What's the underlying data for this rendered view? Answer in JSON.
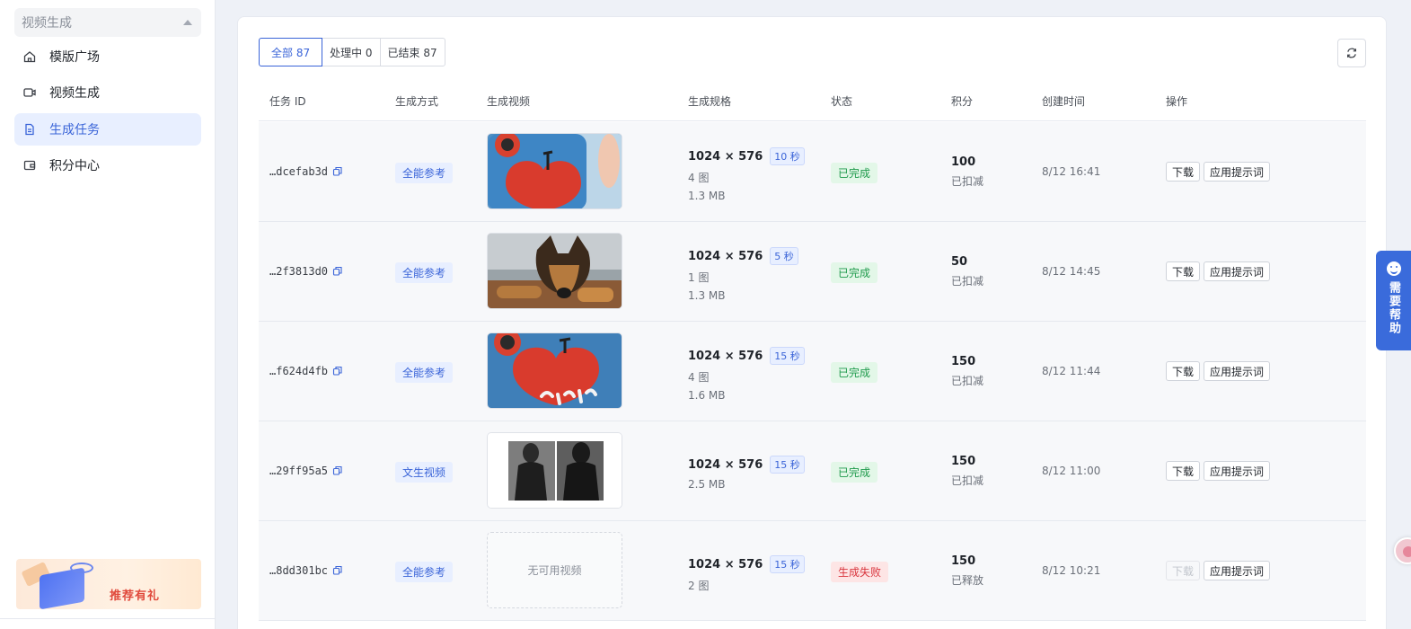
{
  "sidebar": {
    "group_label": "视频生成",
    "items": [
      {
        "label": "模版广场",
        "icon": "home-icon",
        "active": false
      },
      {
        "label": "视频生成",
        "icon": "video-camera-icon",
        "active": false
      },
      {
        "label": "生成任务",
        "icon": "document-icon",
        "active": true
      },
      {
        "label": "积分中心",
        "icon": "wallet-icon",
        "active": false
      }
    ],
    "promo_text": "推荐有礼"
  },
  "tabs": [
    {
      "label": "全部 87",
      "active": true
    },
    {
      "label": "处理中 0",
      "active": false
    },
    {
      "label": "已结束 87",
      "active": false
    }
  ],
  "table": {
    "headers": [
      "任务 ID",
      "生成方式",
      "生成视频",
      "生成规格",
      "状态",
      "积分",
      "创建时间",
      "操作"
    ],
    "rows": [
      {
        "task_id": "…dcefab3d",
        "method": "全能参考",
        "thumb": "phone-heart",
        "resolution": "1024 × 576",
        "duration": "10 秒",
        "images": "4 图",
        "size": "1.3 MB",
        "status": "已完成",
        "status_type": "ok",
        "points": "100",
        "points_note": "已扣减",
        "time": "8/12 16:41",
        "download": "下载",
        "apply": "应用提示词",
        "download_disabled": false
      },
      {
        "task_id": "…2f3813d0",
        "method": "全能参考",
        "thumb": "dog",
        "resolution": "1024 × 576",
        "duration": "5 秒",
        "images": "1 图",
        "size": "1.3 MB",
        "status": "已完成",
        "status_type": "ok",
        "points": "50",
        "points_note": "已扣减",
        "time": "8/12 14:45",
        "download": "下载",
        "apply": "应用提示词",
        "download_disabled": false
      },
      {
        "task_id": "…f624d4fb",
        "method": "全能参考",
        "thumb": "phone-apple",
        "resolution": "1024 × 576",
        "duration": "15 秒",
        "images": "4 图",
        "size": "1.6 MB",
        "status": "已完成",
        "status_type": "ok",
        "points": "150",
        "points_note": "已扣减",
        "time": "8/12 11:44",
        "download": "下载",
        "apply": "应用提示词",
        "download_disabled": false
      },
      {
        "task_id": "…29ff95a5",
        "method": "文生视频",
        "thumb": "people",
        "resolution": "1024 × 576",
        "duration": "15 秒",
        "images": "",
        "size": "2.5 MB",
        "status": "已完成",
        "status_type": "ok",
        "points": "150",
        "points_note": "已扣减",
        "time": "8/12 11:00",
        "download": "下载",
        "apply": "应用提示词",
        "download_disabled": false
      },
      {
        "task_id": "…8dd301bc",
        "method": "全能参考",
        "thumb": "none",
        "empty_text": "无可用视频",
        "resolution": "1024 × 576",
        "duration": "15 秒",
        "images": "2 图",
        "size": "",
        "status": "生成失败",
        "status_type": "fail",
        "points": "150",
        "points_note": "已释放",
        "time": "8/12 10:21",
        "download": "下载",
        "apply": "应用提示词",
        "download_disabled": true
      }
    ]
  },
  "help": {
    "label": "需要帮助"
  },
  "colors": {
    "accent": "#3a64d8",
    "success": "#1e9a4b",
    "danger": "#d9363e",
    "help_bg": "#3a6bdb"
  }
}
